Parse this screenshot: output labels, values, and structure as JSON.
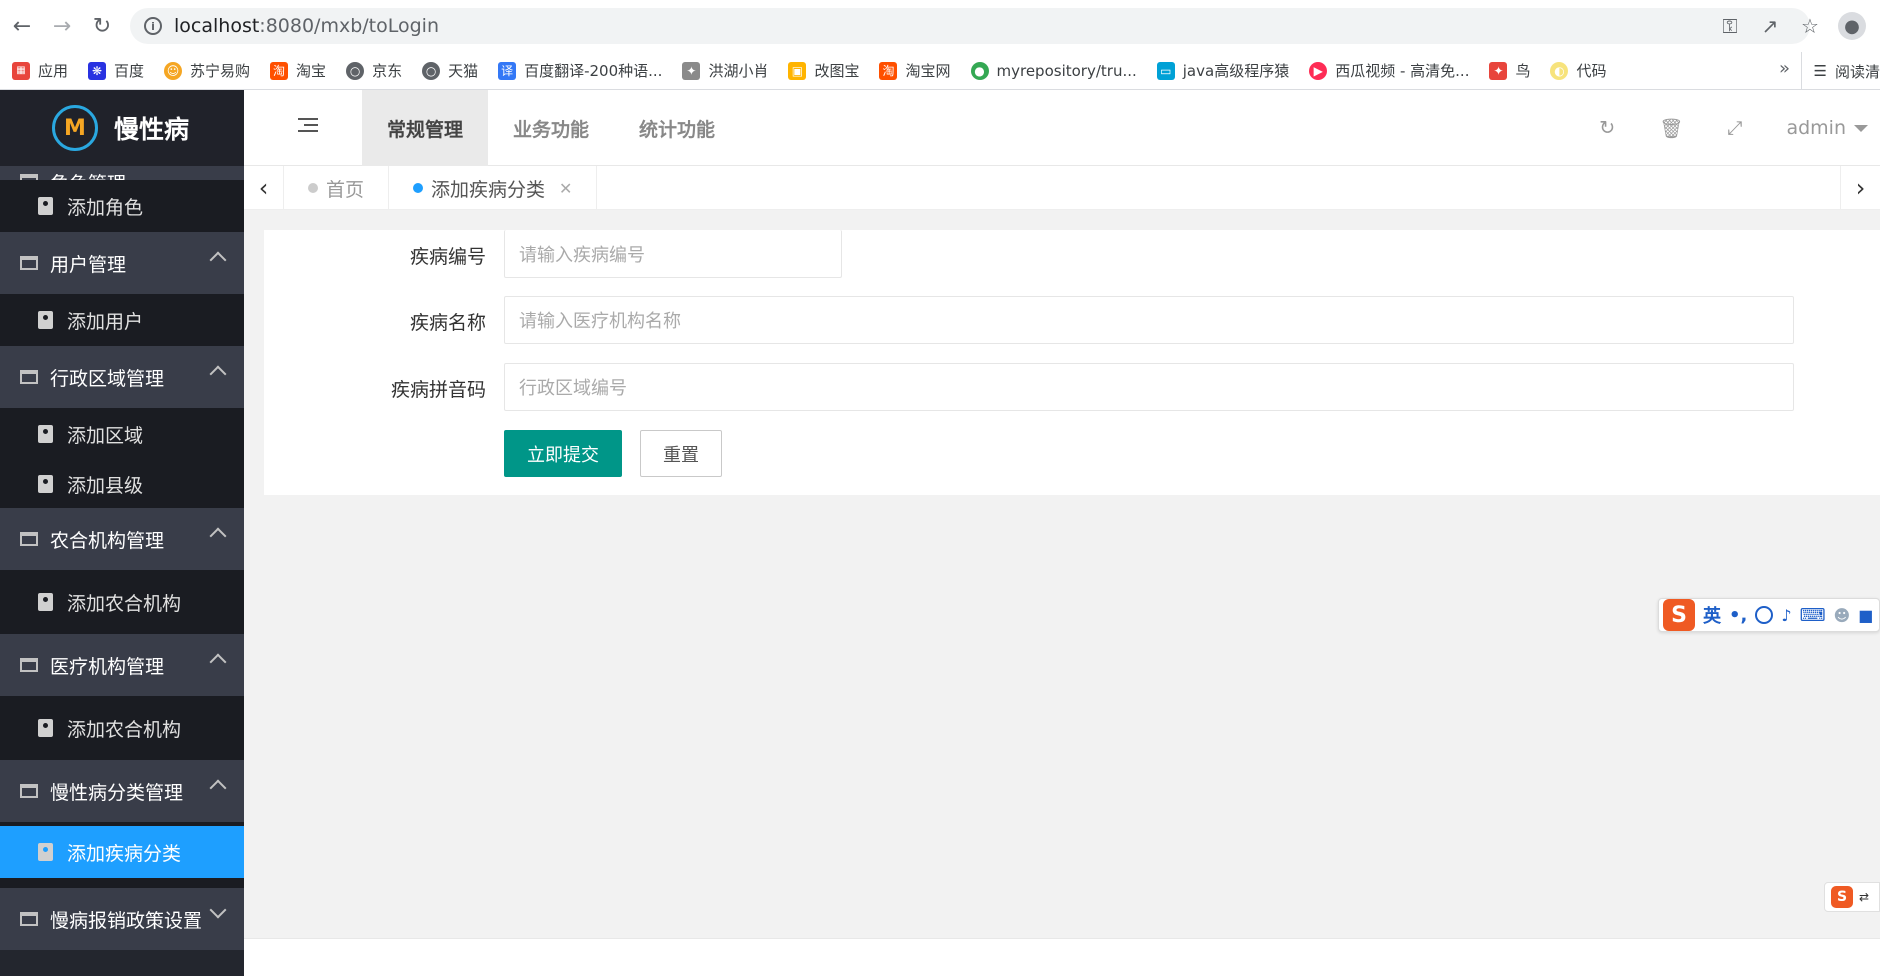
{
  "browser": {
    "url_host": "localhost",
    "url_rest": ":8080/mxb/toLogin",
    "bookmarks": [
      {
        "label": "应用",
        "icon": "apps-grid-icon"
      },
      {
        "label": "百度",
        "icon": "baidu-icon"
      },
      {
        "label": "苏宁易购",
        "icon": "suning-icon"
      },
      {
        "label": "淘宝",
        "icon": "taobao-icon"
      },
      {
        "label": "京东",
        "icon": "globe-icon"
      },
      {
        "label": "天猫",
        "icon": "globe-icon"
      },
      {
        "label": "百度翻译-200种语...",
        "icon": "translate-icon"
      },
      {
        "label": "洪湖小肖",
        "icon": "bird-icon"
      },
      {
        "label": "改图宝",
        "icon": "image-icon"
      },
      {
        "label": "淘宝网",
        "icon": "taobao-icon"
      },
      {
        "label": "myrepository/tru...",
        "icon": "chrome-icon"
      },
      {
        "label": "java高级程序猿",
        "icon": "bilibili-icon"
      },
      {
        "label": "西瓜视频 - 高清免...",
        "icon": "video-icon"
      },
      {
        "label": "鸟",
        "icon": "bird-icon"
      },
      {
        "label": "代码",
        "icon": "lemon-icon"
      }
    ],
    "more": "»",
    "reading_list": "阅读清"
  },
  "app": {
    "logo_text": "慢性病",
    "logo_mark": "M",
    "topnav": [
      "常规管理",
      "业务功能",
      "统计功能"
    ],
    "user": "admin",
    "colors": {
      "sidebar": "#23262e",
      "accent": "#1e9fff",
      "submit": "#009688"
    }
  },
  "sidebar": {
    "cut_group": "角色管理",
    "items": {
      "add_role": "添加角色",
      "user_mgmt": "用户管理",
      "add_user": "添加用户",
      "region_mgmt": "行政区域管理",
      "add_region": "添加区域",
      "add_county": "添加县级",
      "coop_mgmt": "农合机构管理",
      "add_coop": "添加农合机构",
      "medical_mgmt": "医疗机构管理",
      "add_coop2": "添加农合机构",
      "chronic_mgmt": "慢性病分类管理",
      "add_disease": "添加疾病分类",
      "policy": "慢病报销政策设置"
    }
  },
  "tabs": [
    {
      "label": "首页",
      "active": false
    },
    {
      "label": "添加疾病分类",
      "active": true
    }
  ],
  "form": {
    "code_label": "疾病编号",
    "code_placeholder": "请输入疾病编号",
    "name_label": "疾病名称",
    "name_placeholder": "请输入医疗机构名称",
    "pinyin_label": "疾病拼音码",
    "pinyin_placeholder": "行政区域编号",
    "submit": "立即提交",
    "reset": "重置"
  },
  "ime": {
    "logo": "S",
    "mode": "英",
    "punct": "•,"
  }
}
